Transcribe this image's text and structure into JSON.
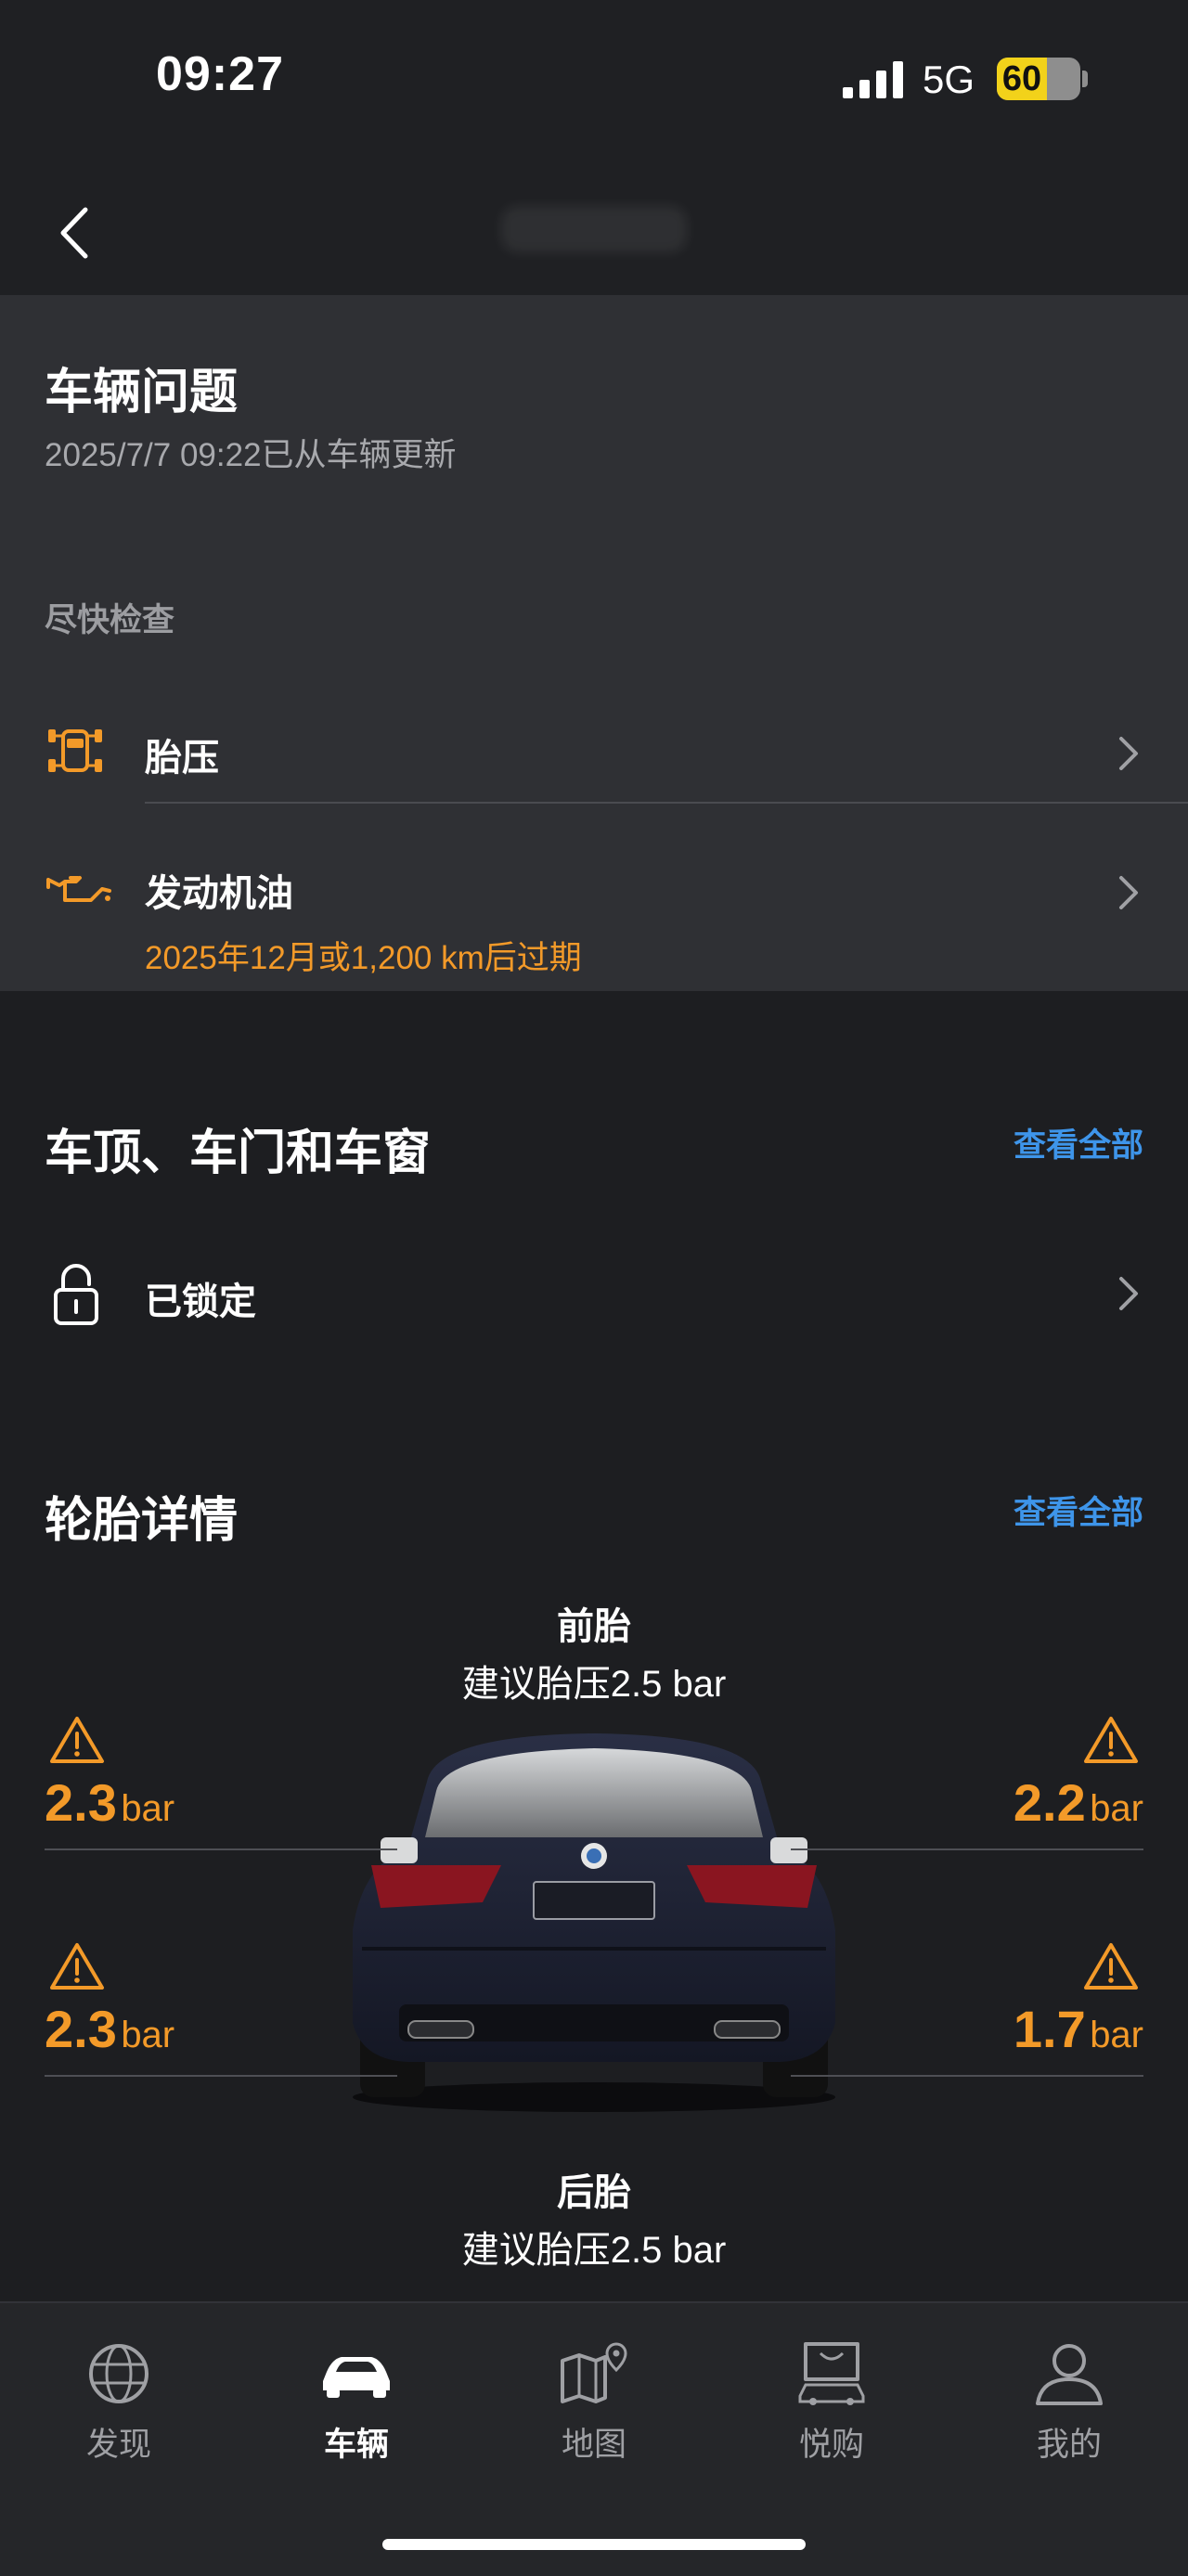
{
  "status_bar": {
    "time": "09:27",
    "network": "5G",
    "battery": "60",
    "battery_level": 0.6
  },
  "issues": {
    "title": "车辆问题",
    "updated": "2025/7/7 09:22已从车辆更新",
    "check_soon_label": "尽快检查",
    "items": [
      {
        "label": "胎压",
        "icon": "tire-pressure-warning-icon"
      },
      {
        "label": "发动机油",
        "icon": "engine-oil-icon",
        "note": "2025年12月或1,200 km后过期"
      }
    ]
  },
  "roof_doors": {
    "title": "车顶、车门和车窗",
    "view_all": "查看全部",
    "status": "已锁定",
    "icon": "lock-icon"
  },
  "tires": {
    "title": "轮胎详情",
    "view_all": "查看全部",
    "front_label": "前胎",
    "front_recommend": "建议胎压2.5 bar",
    "rear_label": "后胎",
    "rear_recommend": "建议胎压2.5 bar",
    "unit": "bar",
    "front_left": "2.3",
    "front_right": "2.2",
    "rear_left": "2.3",
    "rear_right": "1.7",
    "warning_color": "#f39a29"
  },
  "tabbar": {
    "items": [
      {
        "label": "发现",
        "icon": "globe-icon"
      },
      {
        "label": "车辆",
        "icon": "car-icon",
        "active": true
      },
      {
        "label": "地图",
        "icon": "map-icon"
      },
      {
        "label": "悦购",
        "icon": "shopping-bag-icon"
      },
      {
        "label": "我的",
        "icon": "profile-icon"
      }
    ]
  },
  "colors": {
    "accent": "#3e95ea",
    "warning": "#f39a29",
    "background": "#1d1e21",
    "panel": "#2f3034"
  }
}
